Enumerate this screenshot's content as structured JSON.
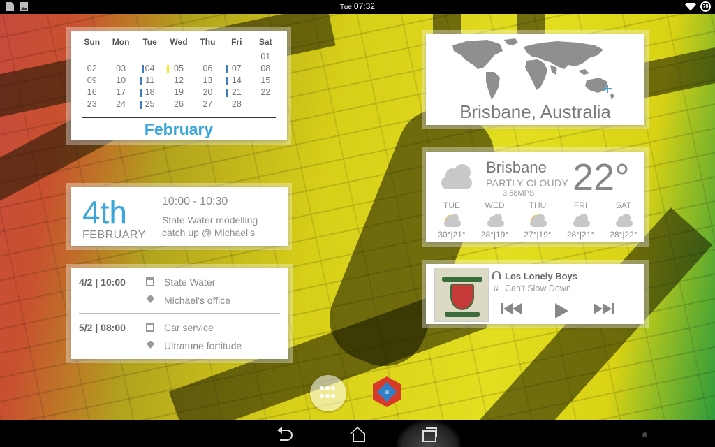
{
  "statusbar": {
    "day": "Tue",
    "time": "07:32",
    "battery": "78"
  },
  "calendar": {
    "weekdays": [
      "Sun",
      "Mon",
      "Tue",
      "Wed",
      "Thu",
      "Fri",
      "Sat"
    ],
    "weeks": [
      [
        "",
        "",
        "",
        "",
        "",
        "",
        "01"
      ],
      [
        "02",
        "03",
        "04",
        "05",
        "06",
        "07",
        "08"
      ],
      [
        "09",
        "10",
        "11",
        "12",
        "13",
        "14",
        "15"
      ],
      [
        "16",
        "17",
        "18",
        "19",
        "20",
        "21",
        "22"
      ],
      [
        "23",
        "24",
        "25",
        "26",
        "27",
        "28",
        ""
      ]
    ],
    "event_days": [
      "07",
      "11",
      "14",
      "18",
      "21",
      "25"
    ],
    "today": "04",
    "month": "February"
  },
  "next_event": {
    "day": "4th",
    "month": "FEBRUARY",
    "time": "10:00 - 10:30",
    "title": "State Water modelling catch up @ Michael's"
  },
  "agenda": [
    {
      "date": "4/2 | 10:00",
      "title": "State Water",
      "location": "Michael's office"
    },
    {
      "date": "5/2 | 08:00",
      "title": "Car service",
      "location": "Ultratune fortitude"
    }
  ],
  "world_clock": {
    "city": "Brisbane, Australia"
  },
  "weather": {
    "city": "Brisbane",
    "condition": "PARTLY CLOUDY",
    "wind": "3.58MPS",
    "temperature": "22°",
    "forecast": [
      {
        "day": "TUE",
        "temps": "30°|21°",
        "icon": "partly-sunny-icon"
      },
      {
        "day": "WED",
        "temps": "28°|19°",
        "icon": "cloudy-icon"
      },
      {
        "day": "THU",
        "temps": "27°|19°",
        "icon": "partly-sunny-icon"
      },
      {
        "day": "FRI",
        "temps": "28°|21°",
        "icon": "cloudy-icon"
      },
      {
        "day": "SAT",
        "temps": "28°|22°",
        "icon": "cloudy-icon"
      }
    ]
  },
  "music": {
    "artist": "Los Lonely Boys",
    "song": "Can't Slow Down"
  },
  "colors": {
    "accent_blue": "#3aa6dc",
    "event_marker": "#3a7cc5",
    "now_marker": "#f5ea1a"
  }
}
